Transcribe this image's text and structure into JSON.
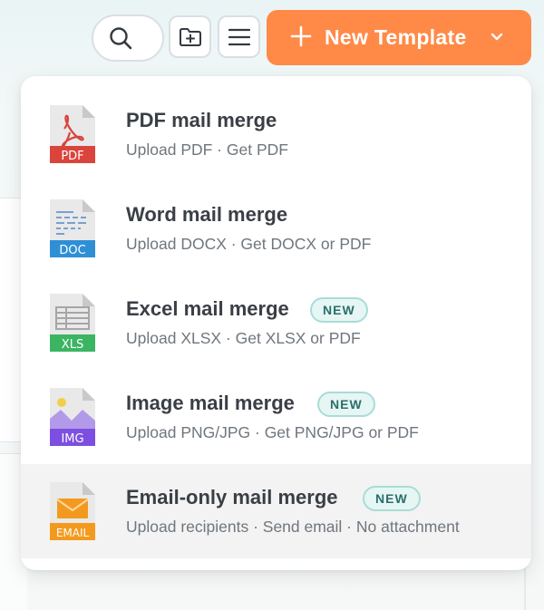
{
  "toolbar": {
    "search_icon": "search-icon",
    "folder_icon": "folder-plus-icon",
    "menu_icon": "menu-icon",
    "new_button_label": "New Template",
    "new_button_color": "#ff8a47"
  },
  "menu": {
    "items": [
      {
        "title": "PDF mail merge",
        "subtitle": "Upload PDF · Get PDF",
        "file_label": "PDF",
        "color": "#d9453d",
        "badge": ""
      },
      {
        "title": "Word mail merge",
        "subtitle": "Upload DOCX · Get DOCX or PDF",
        "file_label": "DOC",
        "color": "#2f8fd6",
        "badge": ""
      },
      {
        "title": "Excel mail merge",
        "subtitle": "Upload XLSX · Get XLSX or PDF",
        "file_label": "XLS",
        "color": "#3cb563",
        "badge": "NEW"
      },
      {
        "title": "Image mail merge",
        "subtitle": "Upload PNG/JPG · Get PNG/JPG or PDF",
        "file_label": "IMG",
        "color": "#7c4fe0",
        "badge": "NEW"
      },
      {
        "title": "Email-only mail merge",
        "subtitle": "Upload recipients · Send email · No attachment",
        "file_label": "EMAIL",
        "color": "#f39a1e",
        "badge": "NEW"
      }
    ]
  }
}
